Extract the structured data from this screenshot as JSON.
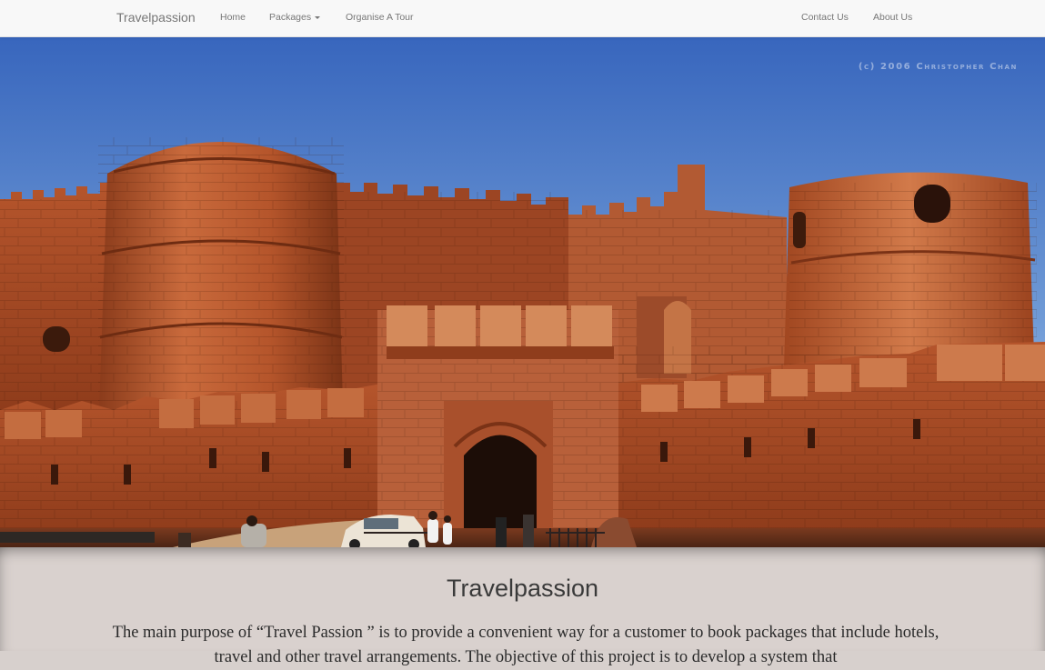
{
  "navbar": {
    "brand": "Travelpassion",
    "home": "Home",
    "packages": "Packages",
    "organise": "Organise A Tour",
    "contact": "Contact Us",
    "about": "About Us"
  },
  "hero": {
    "watermark": "(c) 2006 Christopher Chan"
  },
  "main": {
    "title": "Travelpassion",
    "description": "The main purpose of “Travel Passion ” is to provide a convenient way for a customer to book packages that include hotels, travel and other travel arrangements. The objective of this project is to develop a system that"
  },
  "colors": {
    "sky_top": "#3a6cc0",
    "sky_bottom": "#aac8ea",
    "sandstone": "#b4532a",
    "sandstone_light": "#d07646",
    "sandstone_dark": "#7e3418",
    "panel": "#d9d1ce"
  }
}
